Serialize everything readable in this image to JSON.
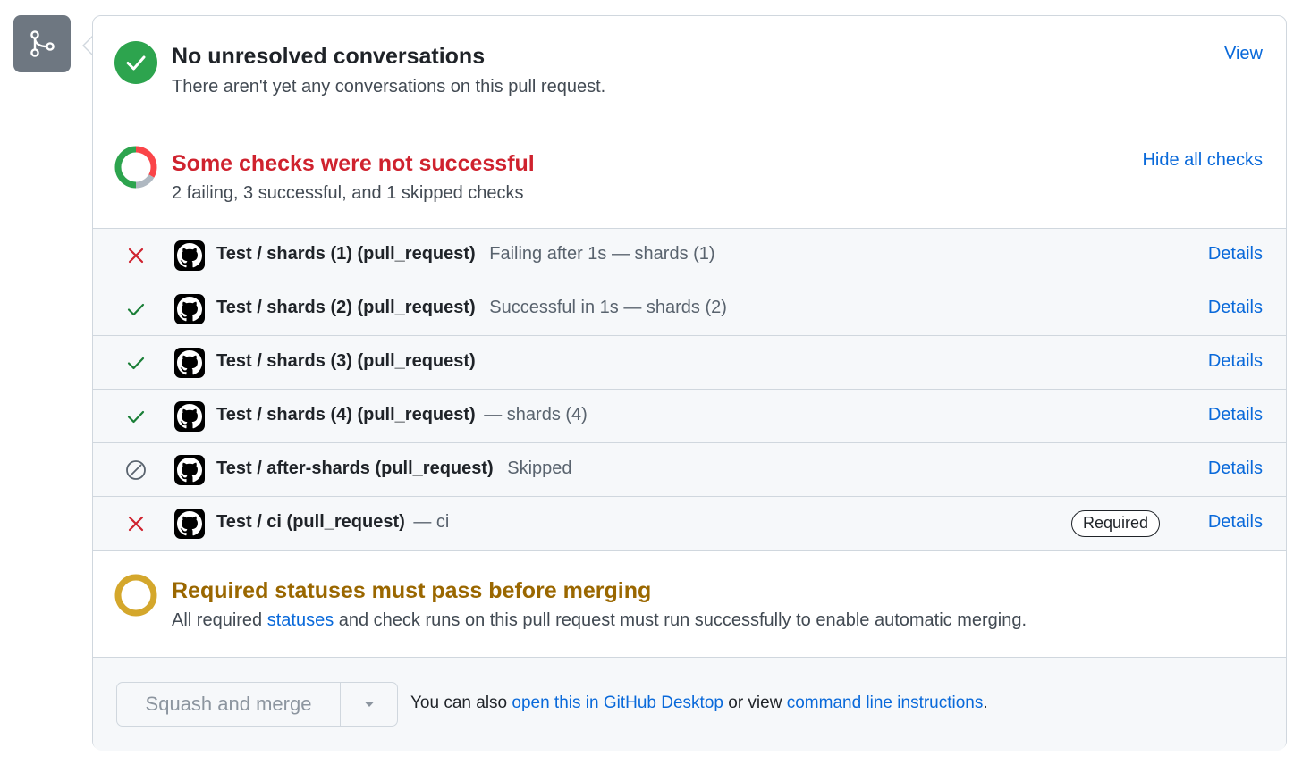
{
  "colors": {
    "success": "#1a7f37",
    "success_bg": "#2da44e",
    "danger": "#cf222e",
    "attention": "#9a6700",
    "attention_ring": "#d4a72c",
    "link": "#0969da",
    "neutral": "#6e7781"
  },
  "merge_badge": {
    "icon": "git-merge-icon"
  },
  "conversations": {
    "icon": "check-circle-icon",
    "title": "No unresolved conversations",
    "subtitle": "There aren't yet any conversations on this pull request.",
    "link": "View"
  },
  "checks_summary": {
    "icon": "checks-donut-icon",
    "title": "Some checks were not successful",
    "subtitle": "2 failing, 3 successful, and 1 skipped checks",
    "link": "Hide all checks",
    "donut": {
      "failing": 2,
      "successful": 3,
      "skipped": 1
    }
  },
  "checks": [
    {
      "status": "failed",
      "icon": "x-icon",
      "name": "Test / shards (1) (pull_request)",
      "description": "Failing after 1s — shards (1)",
      "details": "Details"
    },
    {
      "status": "success",
      "icon": "check-icon",
      "name": "Test / shards (2) (pull_request)",
      "description": "Successful in 1s — shards (2)",
      "details": "Details"
    },
    {
      "status": "success",
      "icon": "check-icon",
      "name": "Test / shards (3) (pull_request)",
      "description": "",
      "details": "Details"
    },
    {
      "status": "success",
      "icon": "check-icon",
      "name": "Test / shards (4) (pull_request)",
      "description": "— shards (4)",
      "details": "Details"
    },
    {
      "status": "skipped",
      "icon": "skip-icon",
      "name": "Test / after-shards (pull_request)",
      "description": "Skipped",
      "details": "Details"
    },
    {
      "status": "failed",
      "icon": "x-icon",
      "name": "Test / ci (pull_request)",
      "description": "— ci",
      "badge": "Required",
      "details": "Details"
    }
  ],
  "required": {
    "icon": "pending-ring-icon",
    "title": "Required statuses must pass before merging",
    "subtitle_before": "All required ",
    "subtitle_link": "statuses",
    "subtitle_after": " and check runs on this pull request must run successfully to enable automatic merging."
  },
  "merge": {
    "button_label": "Squash and merge",
    "caret_icon": "triangle-down-icon",
    "note_before": "You can also ",
    "desktop_link": "open this in GitHub Desktop",
    "note_middle": " or view ",
    "cli_link": "command line instructions",
    "note_after": "."
  }
}
